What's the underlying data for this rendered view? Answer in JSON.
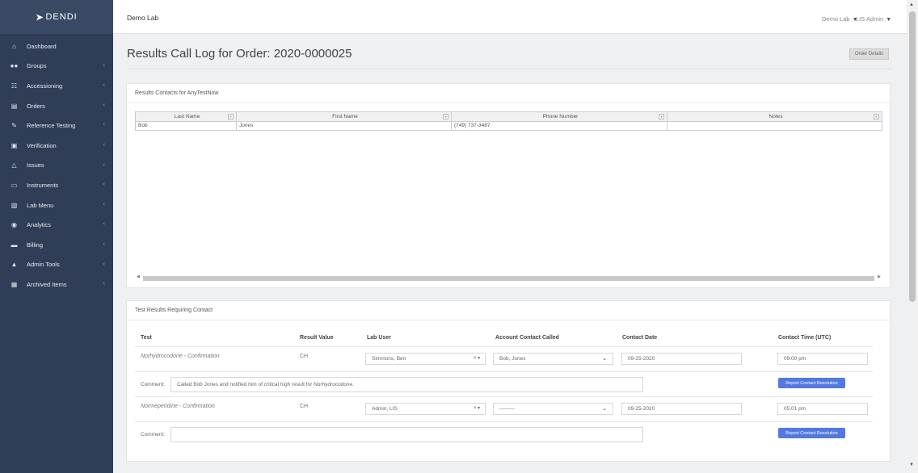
{
  "brand": {
    "name": "DENDI"
  },
  "sidebar": {
    "items": [
      {
        "label": "Dashboard",
        "icon": "home-icon",
        "chevron": false
      },
      {
        "label": "Groups",
        "icon": "users-icon",
        "chevron": true
      },
      {
        "label": "Accessioning",
        "icon": "accessioning-icon",
        "chevron": true
      },
      {
        "label": "Orders",
        "icon": "orders-icon",
        "chevron": true
      },
      {
        "label": "Reference Testing",
        "icon": "edit-icon",
        "chevron": true
      },
      {
        "label": "Verification",
        "icon": "document-icon",
        "chevron": true
      },
      {
        "label": "Issues",
        "icon": "warning-icon",
        "chevron": true
      },
      {
        "label": "Instruments",
        "icon": "monitor-icon",
        "chevron": true
      },
      {
        "label": "Lab Menu",
        "icon": "lab-menu-icon",
        "chevron": true
      },
      {
        "label": "Analytics",
        "icon": "analytics-icon",
        "chevron": true
      },
      {
        "label": "Billing",
        "icon": "billing-icon",
        "chevron": true
      },
      {
        "label": "Admin Tools",
        "icon": "lock-icon",
        "chevron": true
      },
      {
        "label": "Archived Items",
        "icon": "archive-icon",
        "chevron": true
      }
    ]
  },
  "topbar": {
    "lab_name": "Demo Lab",
    "lab_menu": "Demo Lab",
    "user_menu": "LIS Admin"
  },
  "main": {
    "title": "Results Call Log for Order: 2020-0000025",
    "order_details_button": "Order Details"
  },
  "contacts": {
    "title": "Results Contacts for AnyTestNow",
    "columns": [
      "Last Name",
      "First Name",
      "Phone Number",
      "Notes"
    ],
    "rows": [
      [
        "Bob",
        "Jones",
        "(749) 737-3487",
        ""
      ]
    ]
  },
  "results": {
    "title": "Test Results Requiring Contact",
    "columns": [
      "Test",
      "Result Value",
      "Lab User",
      "Account Contact Called",
      "Contact Date",
      "Contact Time (UTC)"
    ],
    "comment_label": "Comment:",
    "button_label": "Report Contact Resolution",
    "rows": [
      {
        "test": "Norhydrocodone - Confirmation",
        "result": "CH",
        "lab_user": "Simmons, Ben",
        "contact": "Bob, Jones",
        "date": "09-25-2020",
        "time": "09:00 pm",
        "comment": "Called Bob Jones and notified him of critical high result for Norhydrocodone."
      },
      {
        "test": "Normeperidine - Confirmation",
        "result": "CH",
        "lab_user": "Admin, LIS",
        "contact": "---------",
        "date": "09-25-2020",
        "time": "05:01 pm",
        "comment": ""
      }
    ]
  },
  "colors": {
    "sidebar": "#2f3d56",
    "sidebar_logo": "#3a4964",
    "accent_button": "#5378e0"
  }
}
